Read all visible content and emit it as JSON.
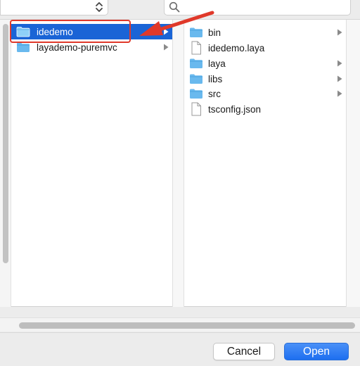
{
  "toolbar": {
    "location_popup_value": "",
    "search": {
      "placeholder": ""
    }
  },
  "column1": {
    "items": [
      {
        "label": "idedemo",
        "type": "folder",
        "selected": true,
        "has_children": true
      },
      {
        "label": "layademo-puremvc",
        "type": "folder",
        "selected": false,
        "has_children": true
      }
    ]
  },
  "column2": {
    "items": [
      {
        "label": "bin",
        "type": "folder",
        "has_children": true
      },
      {
        "label": "idedemo.laya",
        "type": "file",
        "has_children": false
      },
      {
        "label": "laya",
        "type": "folder",
        "has_children": true
      },
      {
        "label": "libs",
        "type": "folder",
        "has_children": true
      },
      {
        "label": "src",
        "type": "folder",
        "has_children": true
      },
      {
        "label": "tsconfig.json",
        "type": "file",
        "has_children": false
      }
    ]
  },
  "footer": {
    "cancel_label": "Cancel",
    "open_label": "Open"
  },
  "colors": {
    "selection": "#1a64d6",
    "folder": "#69b9ee",
    "annotation": "#e0392a",
    "primary_button": "#1d6ff0"
  }
}
